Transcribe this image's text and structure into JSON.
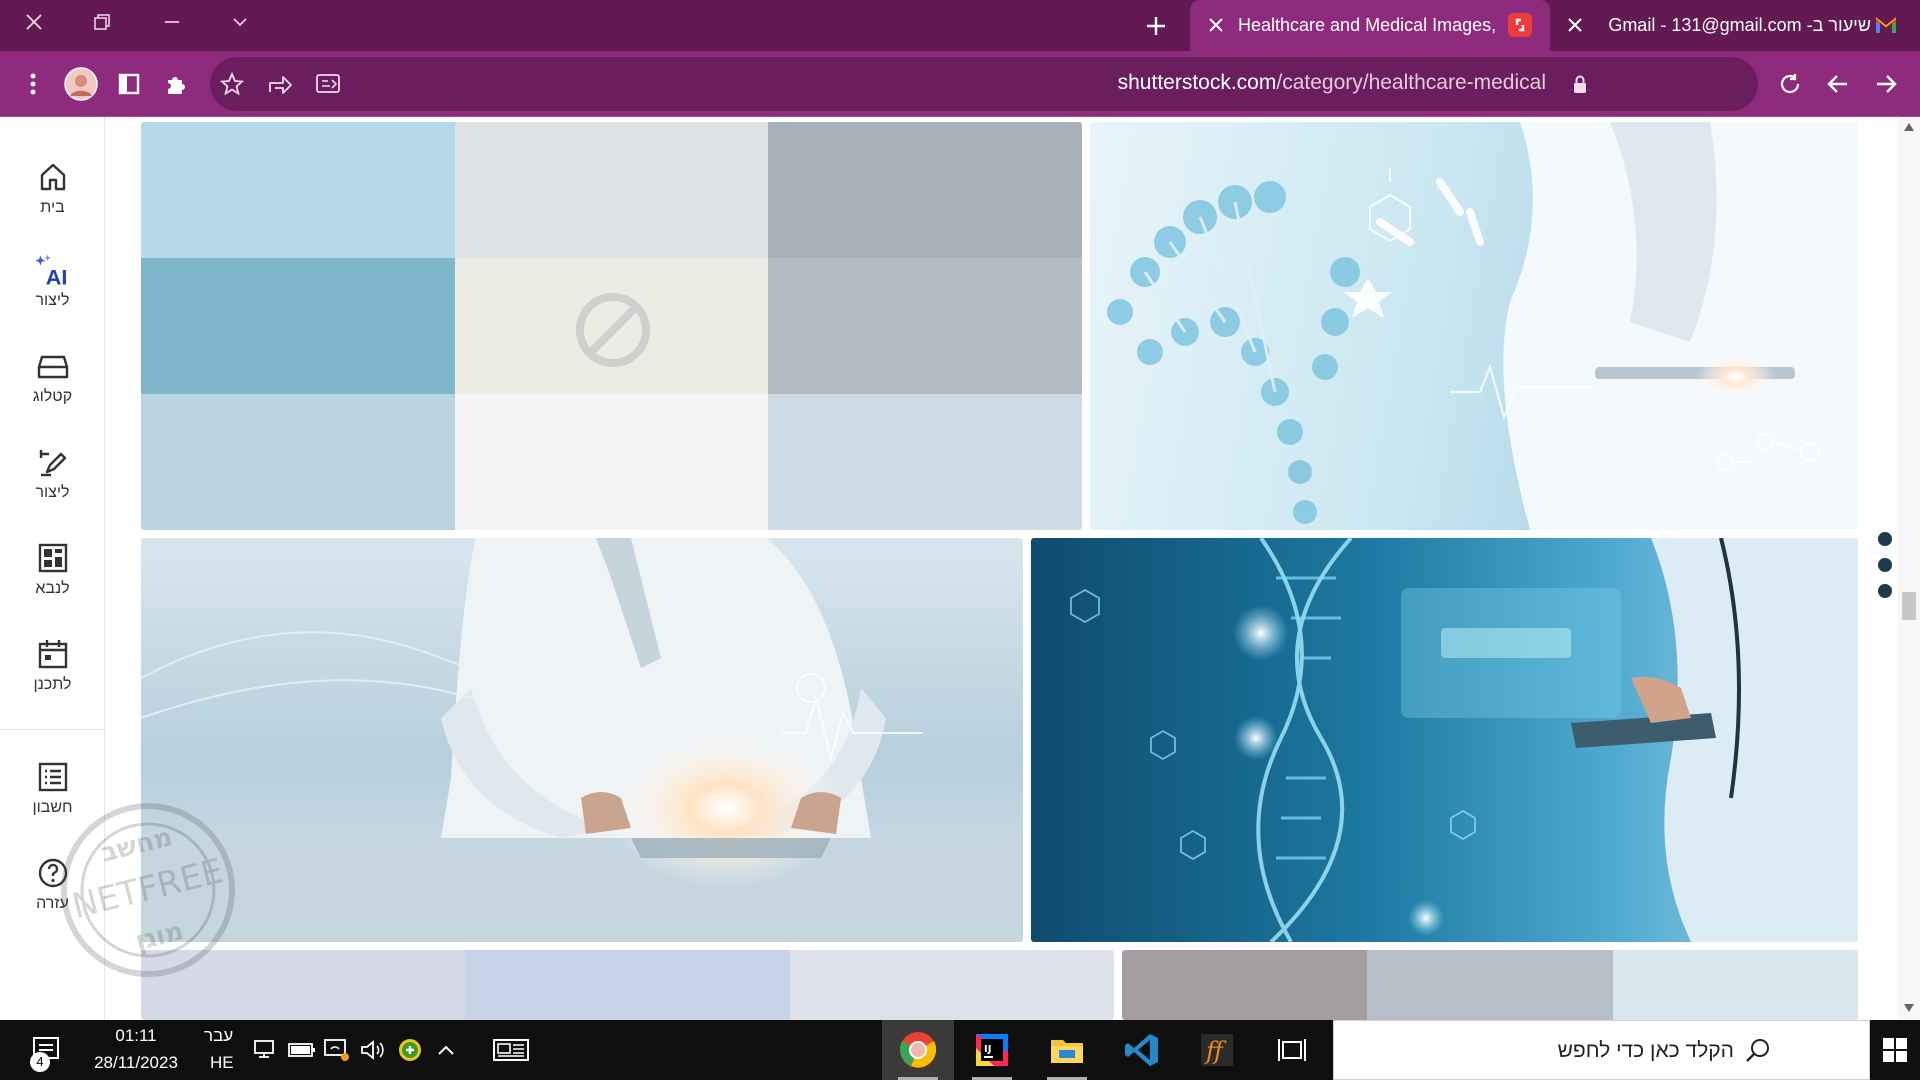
{
  "window_controls": {
    "close_icon": "close-icon",
    "restore_icon": "restore-icon",
    "minimize_icon": "minimize-icon",
    "tab_search_icon": "chevron-down-icon"
  },
  "tabs": [
    {
      "title": "Healthcare and Medical Images,",
      "favicon": "shutterstock-icon",
      "active": true
    },
    {
      "title": "שיעור ב- Gmail - 131@gmail.com",
      "favicon": "gmail-icon",
      "active": false
    }
  ],
  "toolbar": {
    "url_domain": "shutterstock.com",
    "url_path": "/category/healthcare-medical",
    "icons": [
      "menu-kebab-icon",
      "profile-avatar",
      "side-panel-icon",
      "extensions-icon",
      "bookmark-star-icon",
      "share-icon",
      "reading-mode-icon",
      "lock-icon",
      "reload-icon",
      "back-icon",
      "forward-icon"
    ]
  },
  "sidebar": {
    "items": [
      {
        "label": "בית",
        "icon": "home-icon"
      },
      {
        "label": "ליצור",
        "icon": "ai-generate-icon",
        "badge": "AI"
      },
      {
        "label": "קטלוג",
        "icon": "catalog-icon"
      },
      {
        "label": "ליצור",
        "icon": "edit-create-icon"
      },
      {
        "label": "לנבא",
        "icon": "predict-grid-icon"
      },
      {
        "label": "לתכנן",
        "icon": "calendar-icon"
      },
      {
        "label": "חשבון",
        "icon": "account-list-icon"
      },
      {
        "label": "עזרה",
        "icon": "help-icon"
      }
    ]
  },
  "watermark": {
    "text_top": "מחשב",
    "text_mid": "NETFREE",
    "text_bot": "מוגן"
  },
  "content": {
    "tiles": [
      {
        "kind": "placeholder",
        "desc": "blocked-image",
        "colors": [
          "#b5d9e8",
          "#dfe3e5",
          "#a9b0b9",
          "#7fb7cd",
          "#ecebe4",
          "#b4bac3",
          "#bad5e0",
          "#f4f4f6",
          "#cfdbe5"
        ]
      },
      {
        "kind": "photo",
        "desc": "doctor-tablet-dna-helix"
      },
      {
        "kind": "photo",
        "desc": "doctor-holding-glowing-tablet"
      },
      {
        "kind": "photo",
        "desc": "dna-helix-doctor-tablet-blue"
      },
      {
        "kind": "placeholder",
        "desc": "partial-bottom-left",
        "colors": [
          "#d6dae8",
          "#c7d3e6",
          "#dde1ea"
        ]
      },
      {
        "kind": "placeholder",
        "desc": "partial-bottom-right",
        "colors": [
          "#a59e9e",
          "#b7c0c9",
          "#d9e6ee"
        ]
      }
    ]
  },
  "taskbar": {
    "search_placeholder": "הקלד כאן כדי לחפש",
    "time": "01:11",
    "date": "28/11/2023",
    "lang_top": "עבר",
    "lang_bottom": "HE",
    "notifications_count": "4",
    "apps": [
      "chrome-icon",
      "intellij-icon",
      "file-explorer-icon",
      "vscode-icon",
      "fontforge-icon",
      "task-view-icon"
    ],
    "tray_icons": [
      "news-widget-icon",
      "tray-chevron-icon",
      "security-icon",
      "volume-icon",
      "display-icon",
      "battery-icon",
      "network-icon"
    ]
  }
}
